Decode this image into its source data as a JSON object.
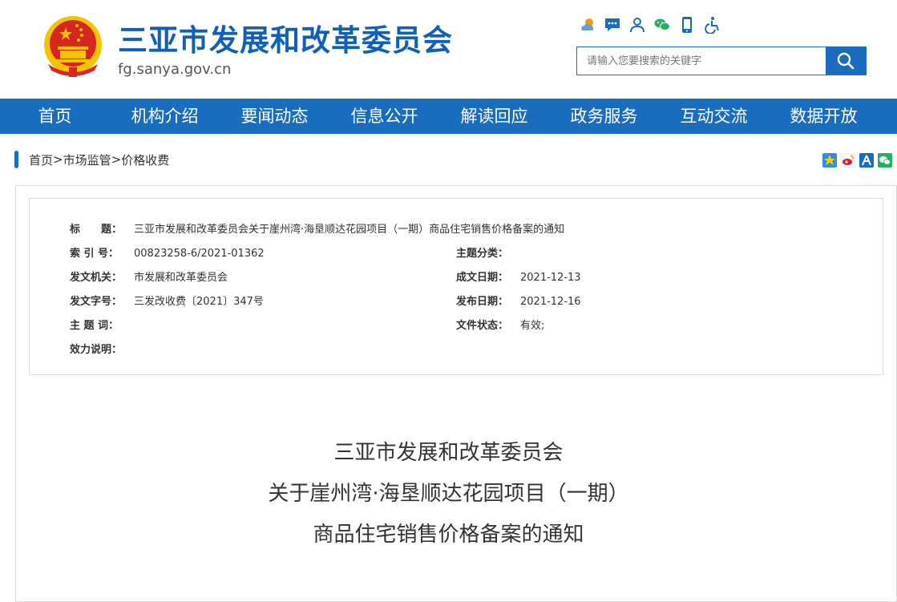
{
  "header": {
    "site_title": "三亚市发展和改革委员会",
    "domain": "fg.sanya.gov.cn",
    "tool_icons": [
      "weather-icon",
      "message-icon",
      "user-icon",
      "wechat-icon",
      "mobile-icon",
      "accessibility-icon"
    ],
    "search": {
      "placeholder": "请输入您要搜索的关键字"
    }
  },
  "colors": {
    "primary": "#1a6cbf",
    "title_blue": "#1160b8",
    "emblem_red": "#d7261d",
    "emblem_gold": "#f5c400"
  },
  "nav": {
    "items": [
      "首页",
      "机构介绍",
      "要闻动态",
      "信息公开",
      "解读回应",
      "政务服务",
      "互动交流",
      "数据开放"
    ]
  },
  "breadcrumb": {
    "home": "首页",
    "sep": ">",
    "level1": "市场监管",
    "level2": "价格收费"
  },
  "share_icons": [
    "qzone-icon",
    "weibo-icon",
    "renren-icon",
    "wechat-share-icon"
  ],
  "meta": {
    "title_label": "标　　题：",
    "title_value": "三亚市发展和改革委员会关于崖州湾·海垦顺达花园项目（一期）商品住宅销售价格备案的通知",
    "index_label": "索 引 号：",
    "index_value": "00823258-6/2021-01362",
    "category_label": "主题分类：",
    "category_value": "",
    "issuer_label": "发文机关：",
    "issuer_value": "市发展和改革委员会",
    "written_label": "成文日期：",
    "written_value": "2021-12-13",
    "docno_label": "发文字号：",
    "docno_value": "三发改收费〔2021〕347号",
    "publish_label": "发布日期：",
    "publish_value": "2021-12-16",
    "keywords_label": "主 题 词：",
    "keywords_value": "",
    "status_label": "文件状态：",
    "status_value": "有效;",
    "validity_label": "效力说明：",
    "validity_value": ""
  },
  "doc": {
    "title_line1": "三亚市发展和改革委员会",
    "title_line2": "关于崖州湾·海垦顺达花园项目（一期）",
    "title_line3": "商品住宅销售价格备案的通知"
  }
}
